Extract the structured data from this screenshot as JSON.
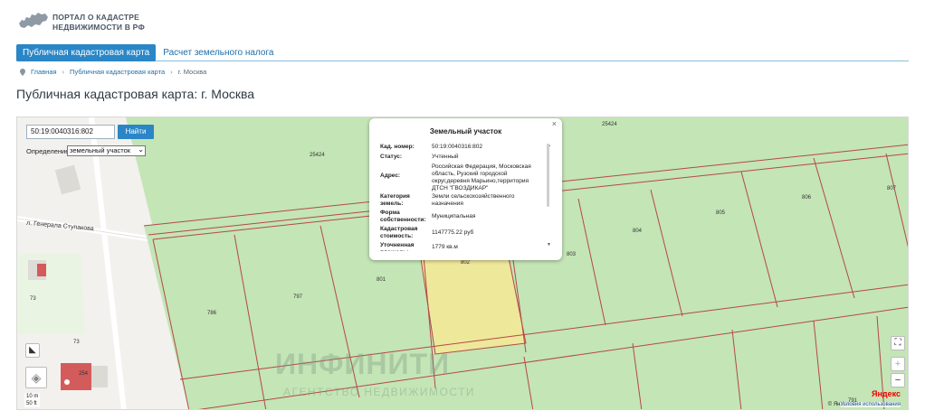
{
  "header": {
    "logo_line1": "ПОРТАЛ О КАДАСТРЕ",
    "logo_line2": "НЕДВИЖИМОСТИ В РФ"
  },
  "tabs": [
    {
      "label": "Публичная кадастровая карта",
      "active": true
    },
    {
      "label": "Расчет земельного налога",
      "active": false
    }
  ],
  "breadcrumb": {
    "home": "Главная",
    "section": "Публичная кадастровая карта",
    "current": "г. Москва",
    "sep": "›"
  },
  "page_title": "Публичная кадастровая карта: г. Москва",
  "map": {
    "search_value": "50:19:0040316:802",
    "search_button": "Найти",
    "definition_label": "Определение:",
    "definition_value": "земельный участок",
    "street_name": "л. Генерала Ступакова",
    "labels": {
      "l25424a": "25424",
      "l25424b": "25424",
      "l801": "801",
      "l802": "802",
      "l803": "803",
      "l804": "804",
      "l805": "805",
      "l806": "806",
      "l807": "807",
      "l797": "797",
      "l786": "786",
      "l73a": "73",
      "l73b": "73",
      "l254": "254",
      "l791": "791"
    },
    "watermark": "ИНФИНИТИ",
    "watermark_sub": "АГЕНТСТВО НЕДВИЖИМОСТИ",
    "scale_top": "10 m",
    "scale_bottom": "50 ft",
    "copyright": "© Яндекс",
    "terms": "Условия использования",
    "yandex": "Яндекс",
    "zoom_in": "+",
    "zoom_out": "−",
    "fullscreen": "⛶",
    "ruler": "◣",
    "layers": "◈"
  },
  "popup": {
    "title": "Земельный участок",
    "close": "×",
    "rows": [
      {
        "label": "Кад. номер:",
        "value": "50:19:0040316:802"
      },
      {
        "label": "Статус:",
        "value": "Учтенный"
      },
      {
        "label": "Адрес:",
        "value": "Российская Федерация, Московская область, Рузский городской округ,деревня Марьино,территория ДТСН \"ГВОЗДИКАР\""
      },
      {
        "label": "Категория земель:",
        "value": "Земли сельскохозяйственного назначения"
      },
      {
        "label": "Форма собственности:",
        "value": "Муниципальная"
      },
      {
        "label": "Кадастровая стоимость:",
        "value": "1147775.22 руб"
      },
      {
        "label": "Уточненная площадь:",
        "value": "1779 кв.м"
      }
    ]
  },
  "colors": {
    "accent": "#2a86c6",
    "map_green": "#c4e5b6",
    "selected_plot": "#eee89a",
    "boundary": "#b44848"
  }
}
